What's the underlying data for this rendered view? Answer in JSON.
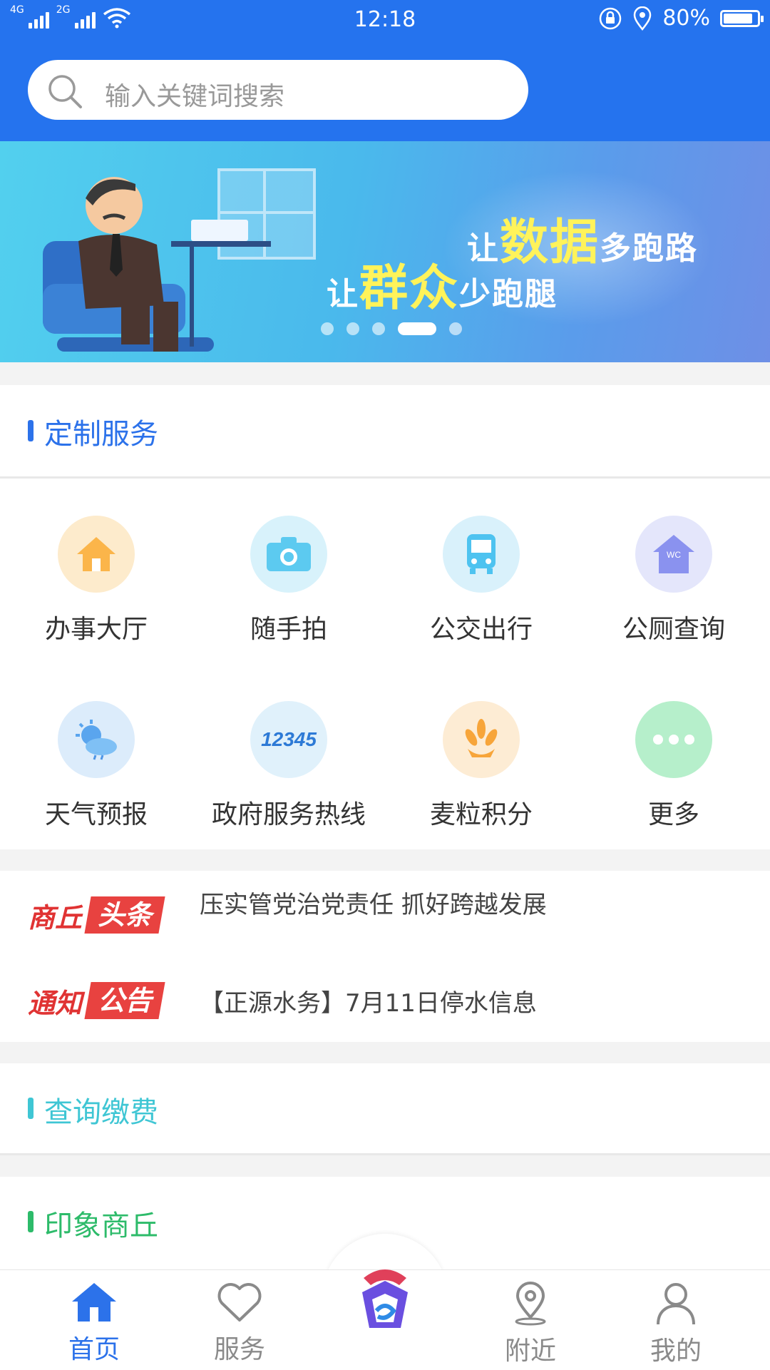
{
  "status_bar": {
    "network_left": "4G",
    "network_right": "2G",
    "time": "12:18",
    "battery": "80%",
    "battery_level": 0.8
  },
  "search": {
    "placeholder": "输入关键词搜索"
  },
  "banner": {
    "line1_prefix": "让",
    "line1_highlight": "数据",
    "line1_suffix": "多跑路",
    "line2_prefix": "让",
    "line2_highlight": "群众",
    "line2_suffix": "少跑腿",
    "active_slide": 4,
    "slide_count": 5
  },
  "sections": {
    "custom": {
      "title": "定制服务",
      "color": "#2c72ea"
    },
    "query": {
      "title": "查询缴费",
      "color": "#3fc6d4"
    },
    "impression": {
      "title": "印象商丘",
      "color": "#2dbb6a"
    }
  },
  "services": [
    {
      "label": "办事大厅",
      "icon": "house-icon",
      "color": "#fdebcc"
    },
    {
      "label": "随手拍",
      "icon": "camera-icon",
      "color": "#d8f2fb"
    },
    {
      "label": "公交出行",
      "icon": "bus-icon",
      "color": "#d9f1fb"
    },
    {
      "label": "公厕查询",
      "icon": "toilet-icon",
      "color": "#e4e6fb"
    },
    {
      "label": "天气预报",
      "icon": "weather-icon",
      "color": "#dcecfb"
    },
    {
      "label": "政府服务热线",
      "icon": "hotline-12345-icon",
      "icon_text": "12345",
      "color": "#e0f1fb"
    },
    {
      "label": "麦粒积分",
      "icon": "wheat-icon",
      "color": "#fdecd4"
    },
    {
      "label": "更多",
      "icon": "more-icon",
      "color": "#b6efcb"
    }
  ],
  "news": [
    {
      "tag_a": "商丘",
      "tag_b": "头条",
      "text": "压实管党治党责任 抓好跨越发展"
    },
    {
      "tag_a": "通知",
      "tag_b": "公告",
      "text": "【正源水务】7月11日停水信息"
    }
  ],
  "bottom_nav": [
    {
      "label": "首页",
      "icon": "home-icon",
      "active": true
    },
    {
      "label": "服务",
      "icon": "heart-icon",
      "active": false
    },
    {
      "label": "",
      "icon": "app-logo-icon",
      "active": false
    },
    {
      "label": "附近",
      "icon": "location-icon",
      "active": false
    },
    {
      "label": "我的",
      "icon": "person-icon",
      "active": false
    }
  ]
}
